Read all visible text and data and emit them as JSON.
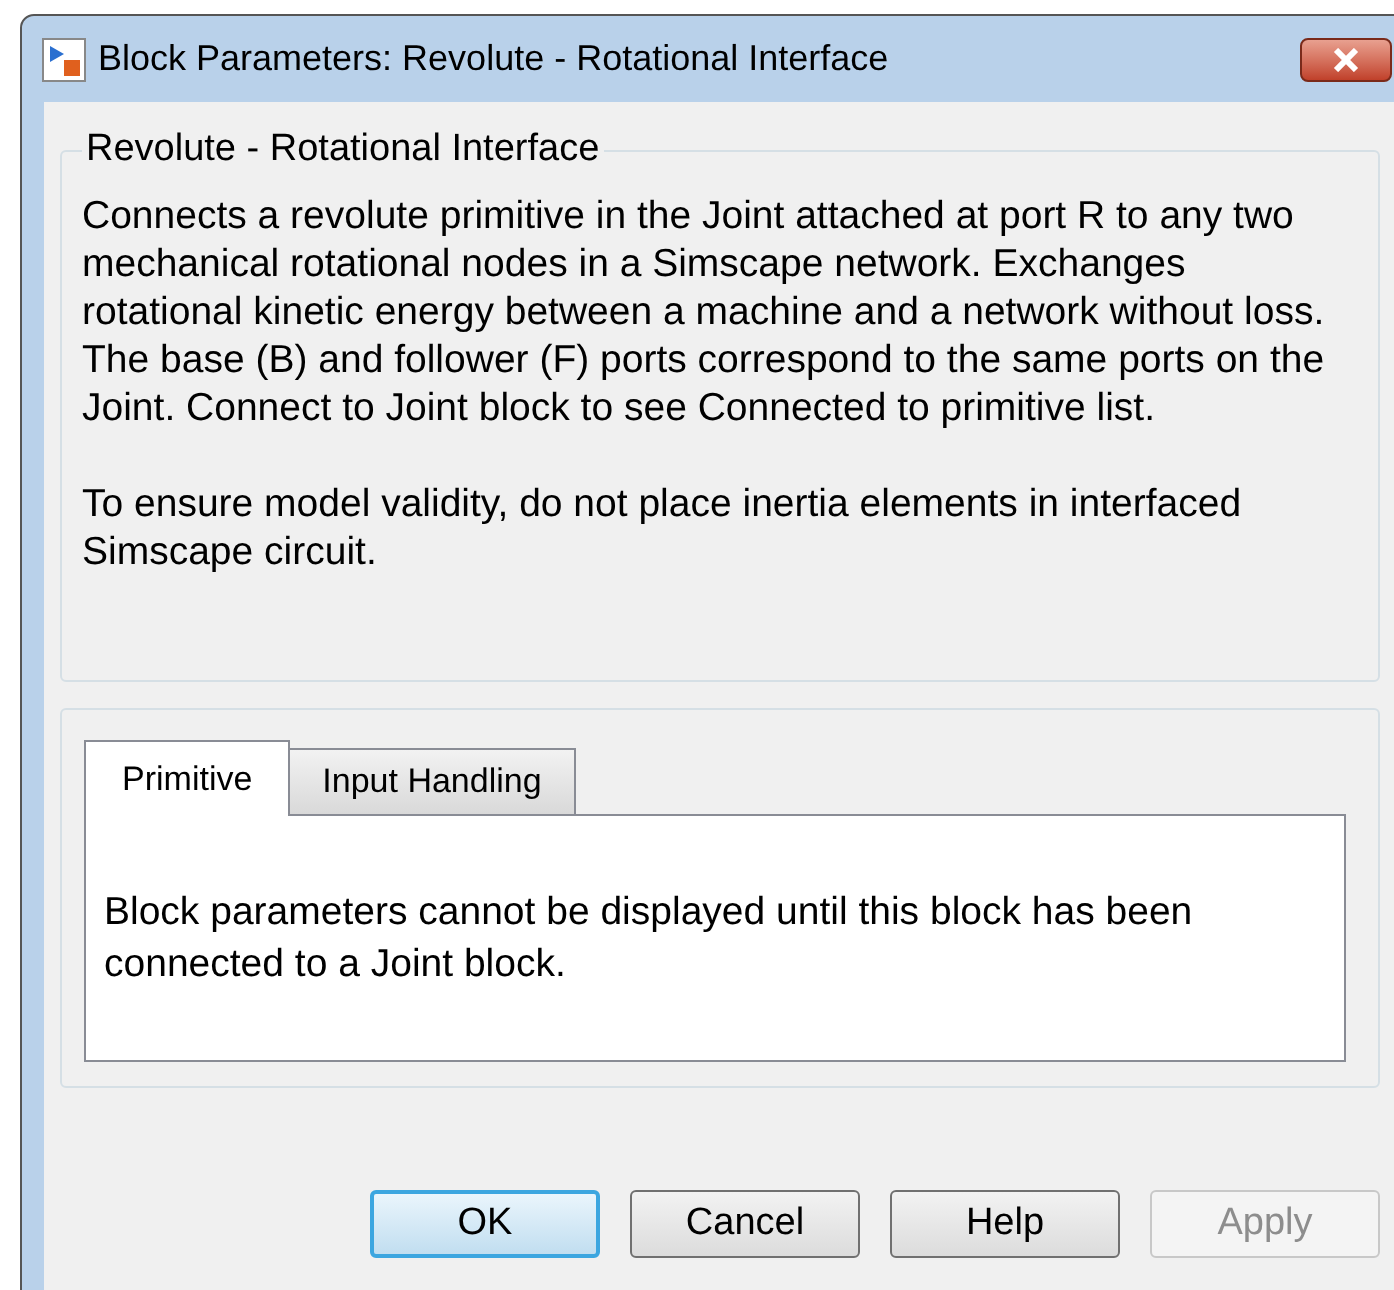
{
  "window": {
    "title": "Block Parameters: Revolute - Rotational Interface"
  },
  "description_group": {
    "title": "Revolute - Rotational Interface",
    "paragraphs": [
      "Connects a revolute primitive in the Joint attached at port R to any two mechanical rotational nodes in a Simscape network. Exchanges rotational kinetic energy between a machine and a network without loss. The base (B) and follower (F) ports correspond to the same ports on the Joint. Connect to Joint block to see Connected to primitive list.",
      "To ensure model validity, do not place inertia elements in interfaced Simscape circuit."
    ]
  },
  "tabs": [
    {
      "label": "Primitive",
      "selected": true
    },
    {
      "label": "Input Handling",
      "selected": false
    }
  ],
  "tab_content": {
    "message": "Block parameters cannot be displayed until this block has been connected to a Joint block."
  },
  "buttons": [
    {
      "label": "OK",
      "default": true,
      "disabled": false
    },
    {
      "label": "Cancel",
      "default": false,
      "disabled": false
    },
    {
      "label": "Help",
      "default": false,
      "disabled": false
    },
    {
      "label": "Apply",
      "default": false,
      "disabled": true
    }
  ]
}
